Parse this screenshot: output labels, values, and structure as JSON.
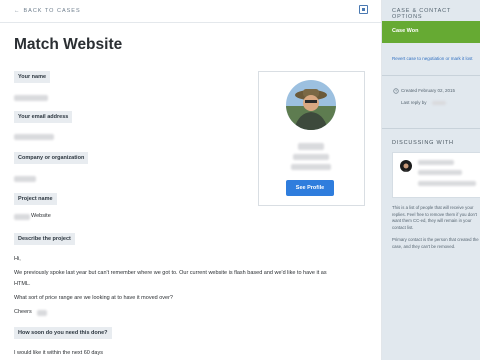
{
  "topbar": {
    "back_label": "BACK TO CASES",
    "back_arrow": "←"
  },
  "case": {
    "title": "Match Website",
    "fields": {
      "name_label": "Your name",
      "email_label": "Your email address",
      "company_label": "Company or organization",
      "project_label": "Project name",
      "project_value_suffix": "Website",
      "describe_label": "Describe the project",
      "message": {
        "hi": "Hi,",
        "line1": "We previously spoke last year but can't remember where we got to. Our current website is flash based and we'd like to have it as",
        "line2": "HTML.",
        "line3": "What sort of price range are we looking at to have it moved over?",
        "cheers": "Cheers"
      },
      "when_label": "How soon do you need this done?",
      "when_value": "I would like it within the next 60 days"
    }
  },
  "contact_card": {
    "see_profile_label": "See Profile"
  },
  "sidebar": {
    "header": "CASE & CONTACT OPTIONS",
    "status": "Case Won",
    "revert_link": "Revert case to negotiation or mark it lost",
    "created": "Created February 02, 2015",
    "last_reply": "Last reply by",
    "discussing_header": "DISCUSSING WITH",
    "help_text_1": "This is a list of people that will receive your replies. Feel free to remove them if you don't want them CC-ed, they will remain in your contact list.",
    "help_text_2": "Primary contact is the person that created the case, and they can't be removed."
  },
  "colors": {
    "accent": "#2f7ddd",
    "won": "#66aa33",
    "sidebar_bg": "#e1e8ee"
  }
}
